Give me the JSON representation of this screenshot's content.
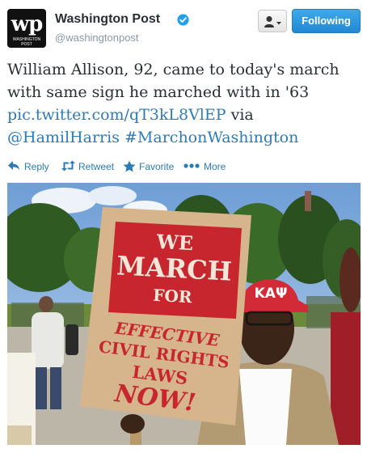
{
  "account": {
    "avatar_logo": "wp",
    "avatar_sub": "WASHINGTON POST",
    "name": "Washington Post",
    "handle": "@washingtonpost",
    "verified_icon": "verified-badge-icon"
  },
  "buttons": {
    "user_menu_icon": "user-dropdown-icon",
    "follow_label": "Following"
  },
  "tweet": {
    "text_plain": "William Allison, 92, came to today's march with same sign he marched with in '63",
    "link": "pic.twitter.com/qT3kL8VlEP",
    "via": "via",
    "mention": "@HamilHarris",
    "hashtag": "#MarchonWashington"
  },
  "actions": {
    "reply": "Reply",
    "retweet": "Retweet",
    "favorite": "Favorite",
    "more": "More"
  },
  "photo": {
    "sign_lines": [
      "WE",
      "MARCH",
      "FOR",
      "EFFECTIVE",
      "CIVIL RIGHTS",
      "LAWS",
      "NOW!"
    ],
    "cap_text": "KAΨ"
  },
  "colors": {
    "link": "#2b7bb9",
    "follow_button": "#2388d4",
    "sign_red": "#c8262e",
    "sign_board": "#d6b58c"
  }
}
